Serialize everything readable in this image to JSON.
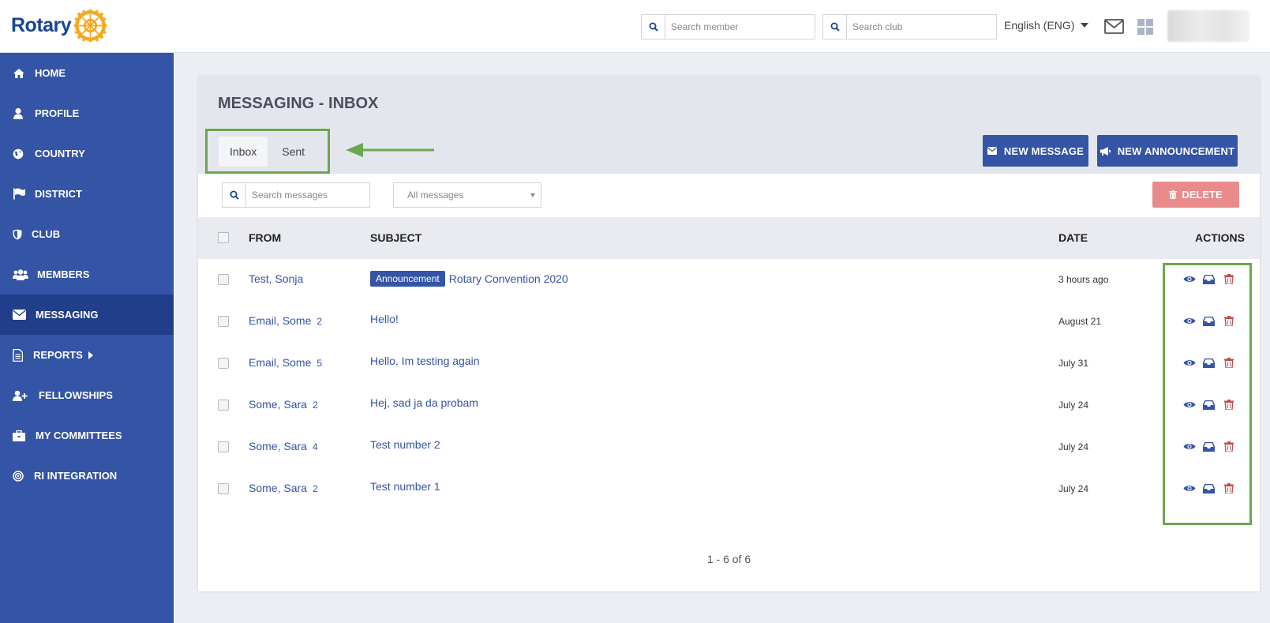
{
  "app": {
    "logo_text": "Rotary",
    "brand_color": "#17458f",
    "accent_color": "#3454a6",
    "gold_color": "#f7a81b",
    "highlight_color": "#6aa84f"
  },
  "header": {
    "search_member_placeholder": "Search member",
    "search_club_placeholder": "Search club",
    "language": "English (ENG)",
    "icons": [
      "search-icon",
      "mail-icon",
      "apps-grid-icon"
    ]
  },
  "sidebar": {
    "items": [
      {
        "label": "HOME",
        "icon": "home-icon"
      },
      {
        "label": "PROFILE",
        "icon": "user-icon"
      },
      {
        "label": "COUNTRY",
        "icon": "globe-icon"
      },
      {
        "label": "DISTRICT",
        "icon": "flag-icon"
      },
      {
        "label": "CLUB",
        "icon": "shield-icon"
      },
      {
        "label": "MEMBERS",
        "icon": "users-icon"
      },
      {
        "label": "MESSAGING",
        "icon": "envelope-icon",
        "active": true
      },
      {
        "label": "REPORTS",
        "icon": "document-icon"
      },
      {
        "label": "FELLOWSHIPS",
        "icon": "user-plus-icon"
      },
      {
        "label": "MY COMMITTEES",
        "icon": "briefcase-icon"
      },
      {
        "label": "RI INTEGRATION",
        "icon": "target-icon"
      }
    ]
  },
  "page": {
    "title": "MESSAGING - INBOX",
    "tabs": [
      {
        "label": "Inbox",
        "active": true
      },
      {
        "label": "Sent"
      }
    ],
    "new_message_label": "NEW MESSAGE",
    "new_announcement_label": "NEW ANNOUNCEMENT",
    "search_messages_placeholder": "Search messages",
    "filter_selected": "All messages",
    "delete_label": "DELETE"
  },
  "table": {
    "columns": {
      "from": "FROM",
      "subject": "SUBJECT",
      "date": "DATE",
      "actions": "ACTIONS"
    },
    "rows": [
      {
        "from": "Test, Sonja",
        "count": "",
        "badge": "Announcement",
        "subject": "Rotary Convention 2020",
        "date": "3 hours ago"
      },
      {
        "from": "Email, Some",
        "count": "2",
        "badge": "",
        "subject": "Hello!",
        "date": "August 21"
      },
      {
        "from": "Email, Some",
        "count": "5",
        "badge": "",
        "subject": "Hello, Im testing again",
        "date": "July 31"
      },
      {
        "from": "Some, Sara",
        "count": "2",
        "badge": "",
        "subject": "Hej, sad ja da probam",
        "date": "July 24"
      },
      {
        "from": "Some, Sara",
        "count": "4",
        "badge": "",
        "subject": "Test number 2",
        "date": "July 24"
      },
      {
        "from": "Some, Sara",
        "count": "2",
        "badge": "",
        "subject": "Test number 1",
        "date": "July 24"
      }
    ],
    "row_action_icons": [
      "eye-icon",
      "inbox-icon",
      "trash-icon"
    ],
    "pagination": "1 - 6 of 6"
  }
}
